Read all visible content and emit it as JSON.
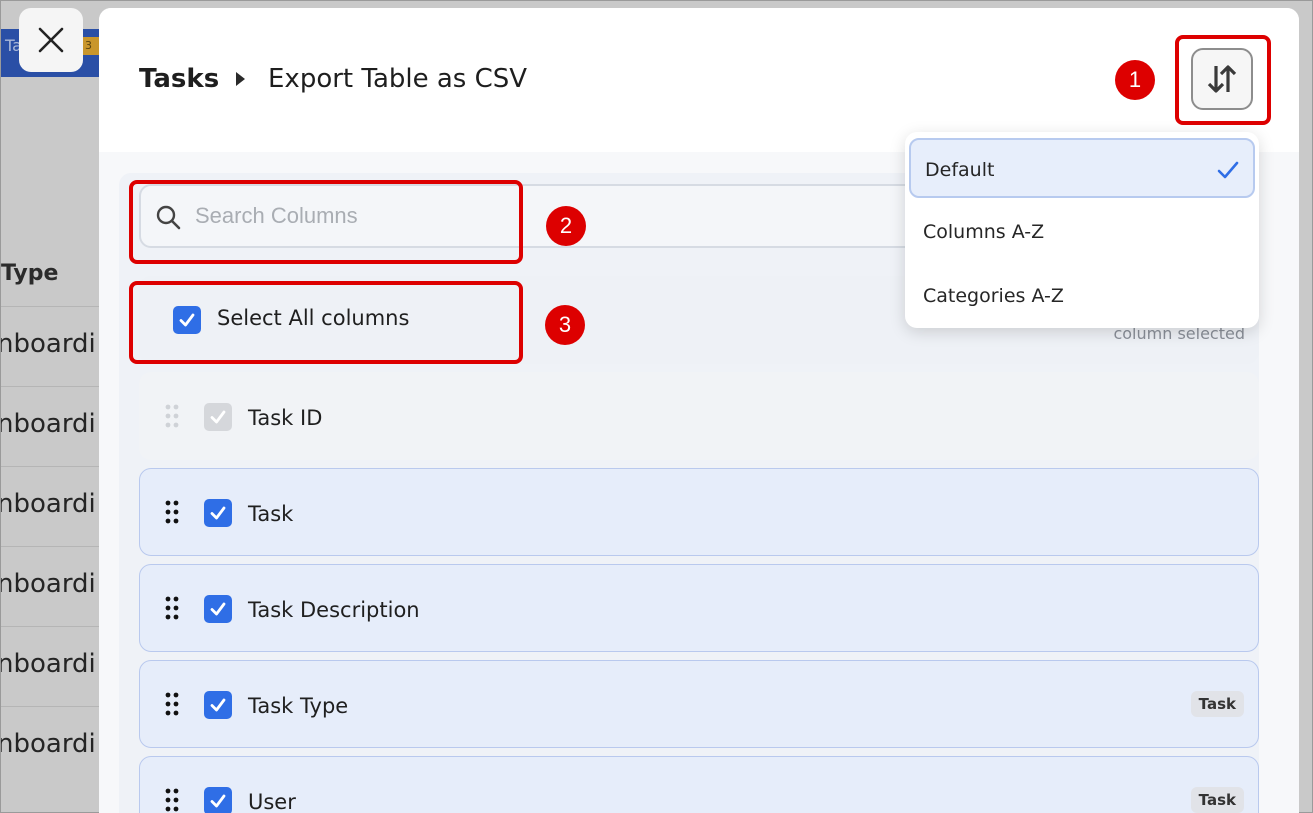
{
  "background": {
    "tab_label": "Ta",
    "tab_badge": "3",
    "column_header": "Type",
    "row_text": "nboardi",
    "rows": [
      "nboardi",
      "nboardi",
      "nboardi",
      "nboardi",
      "nboardi",
      "nboardi"
    ]
  },
  "modal": {
    "breadcrumb_root": "Tasks",
    "breadcrumb_current": "Export Table as CSV",
    "search_placeholder": "Search Columns",
    "select_all_label": "Select All columns",
    "selected_count_text": "column selected",
    "columns": [
      {
        "label": "Task ID",
        "checked": true,
        "locked": true,
        "category": ""
      },
      {
        "label": "Task",
        "checked": true,
        "locked": false,
        "category": ""
      },
      {
        "label": "Task Description",
        "checked": true,
        "locked": false,
        "category": ""
      },
      {
        "label": "Task Type",
        "checked": true,
        "locked": false,
        "category": "Task"
      },
      {
        "label": "User",
        "checked": true,
        "locked": false,
        "category": "Task"
      }
    ]
  },
  "sort_menu": {
    "options": [
      "Default",
      "Columns A-Z",
      "Categories A-Z"
    ],
    "selected": "Default"
  },
  "annotations": [
    "1",
    "2",
    "3"
  ],
  "colors": {
    "accent": "#2f6ee6",
    "annotation": "#dd0000",
    "row_bg": "#e6edfa"
  },
  "icons": {
    "close": "close-icon",
    "sort": "sort-arrows-icon",
    "search": "search-icon",
    "check": "check-icon",
    "drag": "drag-handle-icon"
  }
}
